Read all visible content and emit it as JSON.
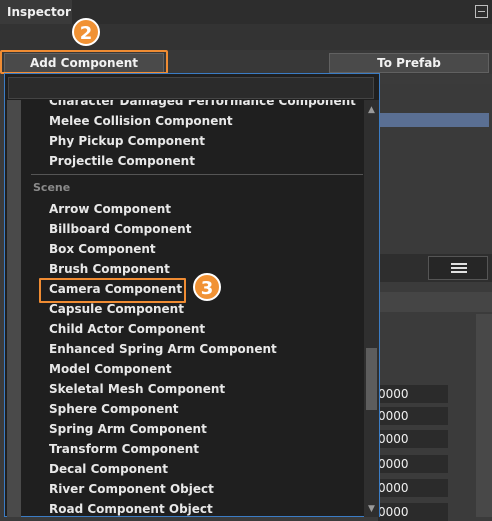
{
  "window": {
    "title": "Inspector"
  },
  "toolbar": {
    "add_label": "Add Component",
    "prefab_label": "To Prefab"
  },
  "badges": {
    "step2": "2",
    "step3": "3"
  },
  "dropdown": {
    "search_value": "",
    "items_before": [
      "Character Damaged Performance Component",
      "Melee Collision Component",
      "Phy Pickup Component",
      "Projectile Component"
    ],
    "category": "Scene",
    "scene_items": [
      "Arrow Component",
      "Billboard Component",
      "Box Component",
      "Brush Component",
      "Camera Component",
      "Capsule Component",
      "Child Actor Component",
      "Enhanced Spring Arm Component",
      "Model Component",
      "Skeletal Mesh Component",
      "Sphere Component",
      "Spring Arm Component",
      "Transform Component",
      "Decal Component",
      "River Component Object",
      "Road Component Object"
    ]
  },
  "fields": [
    "0000",
    "0000",
    "0000",
    "0000",
    "0000",
    "0000"
  ],
  "colors": {
    "highlight": "#f08c33",
    "selection": "#5a6f93",
    "dropdown_border": "#3b7cc4"
  }
}
